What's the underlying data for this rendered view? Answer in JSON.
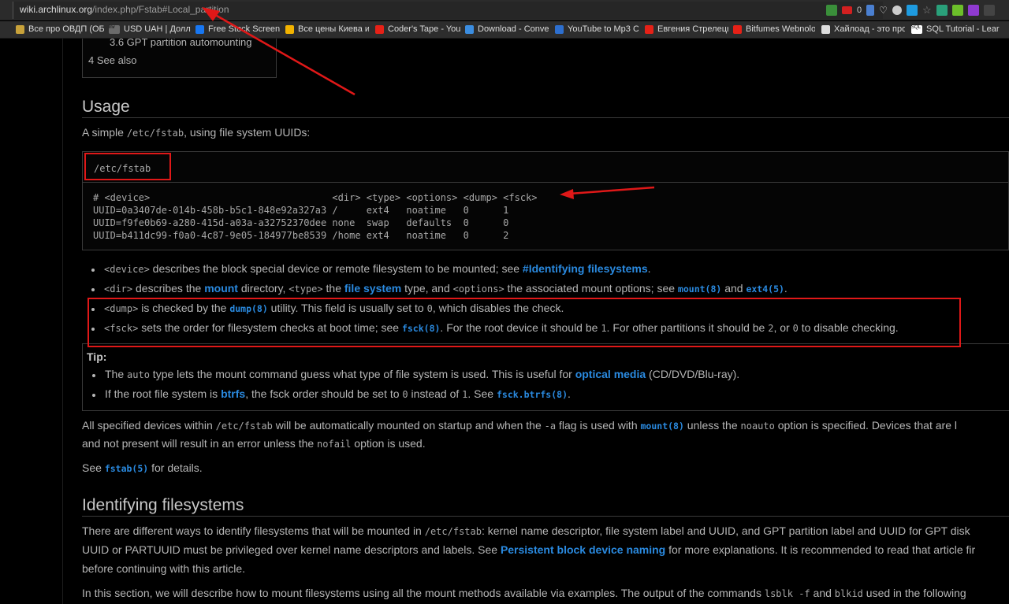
{
  "browser": {
    "url_host": "wiki.archlinux.org",
    "url_path": "/index.php/Fstab#Local_partition",
    "counter": "0",
    "bookmarks": [
      {
        "label": "Все про ОВДП (ОБ",
        "color": "#c8a23a"
      },
      {
        "label": "USD UAH | Долла",
        "color": "#6b6b6b",
        "badge": "inv"
      },
      {
        "label": "Free Stock Screen",
        "color": "#1877f2"
      },
      {
        "label": "Все цены Киева и",
        "color": "#f2b300"
      },
      {
        "label": "Coder's Tape - You",
        "color": "#e62117"
      },
      {
        "label": "Download - Conve",
        "color": "#3b8de0"
      },
      {
        "label": "YouTube to Mp3 C",
        "color": "#2d6fcf"
      },
      {
        "label": "Евгения Стрелецк",
        "color": "#e62117"
      },
      {
        "label": "Bitfumes Webnolo",
        "color": "#e62117"
      },
      {
        "label": "Хайлоад - это про",
        "color": "#dddddd"
      },
      {
        "label": "SQL Tutorial - Lear",
        "color": "#ffffff",
        "badge": "SQL"
      }
    ]
  },
  "toc": {
    "item_36": "3.6  GPT partition automounting",
    "item_4": "4  See also"
  },
  "usage": {
    "heading": "Usage",
    "intro_pre": "A simple ",
    "intro_code": "/etc/fstab",
    "intro_post": ", using file system UUIDs:",
    "file_name": "/etc/fstab",
    "file_lines": [
      "# <device>                                <dir> <type> <options> <dump> <fsck>",
      "UUID=0a3407de-014b-458b-b5c1-848e92a327a3 /     ext4   noatime   0      1",
      "UUID=f9fe0b69-a280-415d-a03a-a32752370dee none  swap   defaults  0      0",
      "UUID=b411dc99-f0a0-4c87-9e05-184977be8539 /home ext4   noatime   0      2"
    ],
    "b1": {
      "code": "<device>",
      "text": " describes the block special device or remote filesystem to be mounted; see ",
      "link": "#Identifying filesystems",
      "end": "."
    },
    "b2": {
      "code1": "<dir>",
      "t1": " describes the ",
      "link1": "mount",
      "t2": " directory, ",
      "code2": "<type>",
      "t3": " the ",
      "link2": "file system",
      "t4": " type, and ",
      "code3": "<options>",
      "t5": " the associated mount options; see ",
      "link3": "mount(8)",
      "t6": " and ",
      "link4": "ext4(5)",
      "end": "."
    },
    "b3": {
      "code1": "<dump>",
      "t1": " is checked by the ",
      "link1": "dump(8)",
      "t2": " utility. This field is usually set to ",
      "code2": "0",
      "t3": ", which disables the check."
    },
    "b4": {
      "code1": "<fsck>",
      "t1": " sets the order for filesystem checks at boot time; see ",
      "link1": "fsck(8)",
      "t2": ". For the root device it should be ",
      "code2": "1",
      "t3": ". For other partitions it should be ",
      "code3": "2",
      "t4": ", or ",
      "code4": "0",
      "t5": " to disable checking."
    }
  },
  "tip": {
    "label": "Tip:",
    "t1": {
      "a": "The ",
      "code": "auto",
      "b": " type lets the mount command guess what type of file system is used. This is useful for ",
      "link": "optical media",
      "c": " (CD/DVD/Blu-ray)."
    },
    "t2": {
      "a": "If the root file system is ",
      "link1": "btrfs",
      "b": ", the fsck order should be set to ",
      "code1": "0",
      "c": " instead of ",
      "code2": "1",
      "d": ". See ",
      "link2": "fsck.btrfs(8)",
      "e": "."
    }
  },
  "para1": {
    "a": "All specified devices within ",
    "code1": "/etc/fstab",
    "b": " will be automatically mounted on startup and when the ",
    "code2": "-a",
    "c": " flag is used with ",
    "link": "mount(8)",
    "d": " unless the ",
    "code3": "noauto",
    "e": " option is specified. Devices that are l"
  },
  "para1b": {
    "a": "and not present will result in an error unless the ",
    "code": "nofail",
    "b": " option is used."
  },
  "para2": {
    "a": "See ",
    "link": "fstab(5)",
    "b": " for details."
  },
  "identifying": {
    "heading": "Identifying filesystems",
    "l1": {
      "a": "There are different ways to identify filesystems that will be mounted in ",
      "code": "/etc/fstab",
      "b": ": kernel name descriptor, file system label and UUID, and GPT partition label and UUID for GPT disk"
    },
    "l2": {
      "a": "UUID or PARTUUID must be privileged over kernel name descriptors and labels. See ",
      "link": "Persistent block device naming",
      "b": " for more explanations. It is recommended to read that article fir"
    },
    "l3": "before continuing with this article.",
    "l4": {
      "a": "In this section, we will describe how to mount filesystems using all the mount methods available via examples. The output of the commands ",
      "code1": "lsblk -f",
      "b": " and ",
      "code2": "blkid",
      "c": " used in the following"
    }
  }
}
